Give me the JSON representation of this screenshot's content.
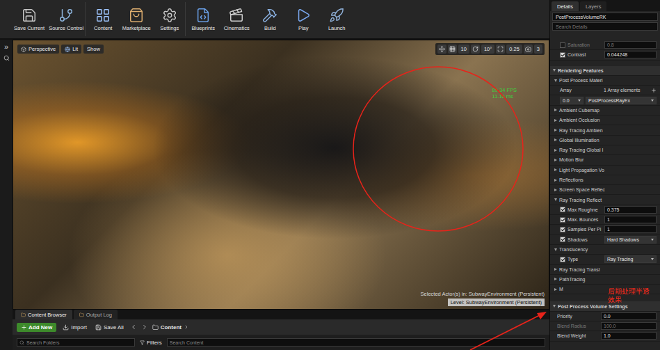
{
  "toolbar": {
    "buttons": [
      {
        "label": "Save Current"
      },
      {
        "label": "Source Control"
      },
      {
        "label": "Content"
      },
      {
        "label": "Marketplace"
      },
      {
        "label": "Settings"
      },
      {
        "label": "Blueprints"
      },
      {
        "label": "Cinematics"
      },
      {
        "label": "Build"
      },
      {
        "label": "Play"
      },
      {
        "label": "Launch"
      }
    ]
  },
  "side_strip": {
    "label": "»"
  },
  "viewport": {
    "view_buttons": [
      {
        "label": "Perspective"
      },
      {
        "label": "Lit"
      },
      {
        "label": "Show"
      }
    ],
    "snap_values": [
      "10",
      "10°",
      "0.25",
      "3"
    ],
    "stats": {
      "fps": "89.34 FPS",
      "ms": "11.10 ms"
    },
    "selected_actor": "Selected Actor(s) in: SubwayEnvironment (Persistent)",
    "level": "Level: SubwayEnvironment (Persistent)"
  },
  "details": {
    "tabs": [
      {
        "label": "Details",
        "selected": true
      },
      {
        "label": "Layers",
        "selected": false
      }
    ],
    "actor_name": "PostProcessVolumeRK",
    "search_placeholder": "Search Details",
    "rows": [
      {
        "kind": "prop",
        "label": "Saturation",
        "value": "0.8",
        "checked": false,
        "disabled": true
      },
      {
        "kind": "prop",
        "label": "Contrast",
        "value": "0.044248",
        "checked": true,
        "disabled": false
      },
      {
        "kind": "section",
        "label": "Rendering Features",
        "expanded": true
      },
      {
        "kind": "group",
        "label": "Post Process Materi",
        "expanded": true
      },
      {
        "kind": "array",
        "label": "Array",
        "value": "1 Array elements"
      },
      {
        "kind": "element",
        "label": "0.0",
        "value": "PostProcessRayEx"
      },
      {
        "kind": "group",
        "label": "Ambient Cubemap",
        "expanded": false
      },
      {
        "kind": "group",
        "label": "Ambient Occlusion",
        "expanded": false
      },
      {
        "kind": "group",
        "label": "Ray Tracing Ambien",
        "expanded": false
      },
      {
        "kind": "group",
        "label": "Global Illumination",
        "expanded": false
      },
      {
        "kind": "group",
        "label": "Ray Tracing Global I",
        "expanded": false
      },
      {
        "kind": "group",
        "label": "Motion Blur",
        "expanded": false
      },
      {
        "kind": "group",
        "label": "Light Propagation Vo",
        "expanded": false
      },
      {
        "kind": "group",
        "label": "Reflections",
        "expanded": false
      },
      {
        "kind": "group",
        "label": "Screen Space Reflec",
        "expanded": false
      },
      {
        "kind": "group",
        "label": "Ray Tracing Reflect",
        "expanded": true
      },
      {
        "kind": "prop",
        "label": "Max Roughne",
        "value": "0.375",
        "checked": true,
        "disabled": false
      },
      {
        "kind": "prop",
        "label": "Max. Bounces",
        "value": "1",
        "checked": true,
        "disabled": false
      },
      {
        "kind": "prop",
        "label": "Samples Per Pi",
        "value": "1",
        "checked": true,
        "disabled": false
      },
      {
        "kind": "select",
        "label": "Shadows",
        "value": "Hard Shadows",
        "checked": true
      },
      {
        "kind": "group",
        "label": "Translucency",
        "expanded": true
      },
      {
        "kind": "select",
        "label": "Type",
        "value": "Ray Tracing",
        "checked": true
      },
      {
        "kind": "group",
        "label": "Ray Tracing Transl",
        "expanded": false
      },
      {
        "kind": "group",
        "label": "PathTracing",
        "expanded": false
      },
      {
        "kind": "group",
        "label": "M",
        "expanded": false
      },
      {
        "kind": "section",
        "label": "Post Process Volume Settings",
        "expanded": true
      },
      {
        "kind": "plain",
        "label": "Priority",
        "value": "0.0",
        "disabled": false
      },
      {
        "kind": "plain",
        "label": "Blend Radius",
        "value": "100.0",
        "disabled": true
      },
      {
        "kind": "plain",
        "label": "Blend Weight",
        "value": "1.0",
        "disabled": false
      }
    ]
  },
  "content_browser": {
    "tabs": [
      {
        "label": "Content Browser",
        "selected": true
      },
      {
        "label": "Output Log",
        "selected": false
      }
    ],
    "add_new": "Add New",
    "import": "Import",
    "save_all": "Save All",
    "path": "Content",
    "folder_search": "Search Folders",
    "filters": "Filters",
    "content_search": "Search Content"
  },
  "annotation": {
    "lines": [
      "后期处理半透",
      "效果"
    ]
  }
}
